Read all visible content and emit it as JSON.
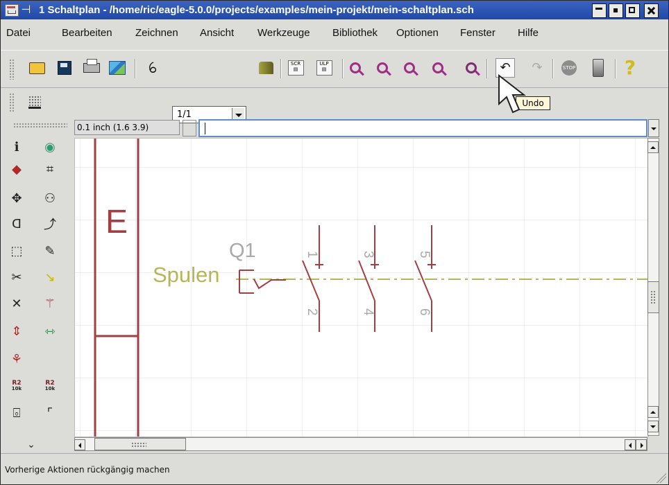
{
  "window": {
    "title": "1 Schaltplan - /home/ric/eagle-5.0.0/projects/examples/mein-projekt/mein-schaltplan.sch",
    "controls": [
      "minimize",
      "restore",
      "maximize",
      "close"
    ]
  },
  "menubar": [
    "Datei",
    "Bearbeiten",
    "Zeichnen",
    "Ansicht",
    "Werkzeuge",
    "Bibliothek",
    "Optionen",
    "Fenster",
    "Hilfe"
  ],
  "toolbar": {
    "sheet_value": "1/1",
    "icons": [
      "open-folder",
      "save-floppy",
      "print",
      "cam-processor",
      "sheet-select",
      "library",
      "script",
      "ulp",
      "zoom-fit",
      "zoom-in",
      "zoom-out",
      "zoom-area",
      "redraw",
      "undo",
      "redo",
      "stop",
      "go",
      "help"
    ]
  },
  "tooltip": "Undo",
  "coordinate_bar": {
    "grid_readout": "0.1 inch (1.6 3.9)",
    "command_value": ""
  },
  "schematic": {
    "frame_letter": "E",
    "net_label": "Spulen",
    "part_name": "Q1",
    "pin_labels": [
      "1",
      "2",
      "3",
      "4",
      "5",
      "6"
    ],
    "colors": {
      "frame": "#a33e42",
      "net": "#b7b557",
      "grid": "#dcdcdc",
      "text_grey": "#a9a9a9"
    }
  },
  "statusbar": {
    "text": "Vorherige Aktionen rückgängig machen"
  }
}
